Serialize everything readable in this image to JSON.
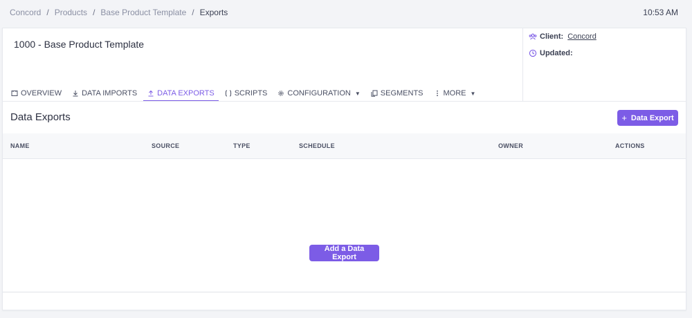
{
  "breadcrumb": {
    "items": [
      "Concord",
      "Products",
      "Base Product Template",
      "Exports"
    ],
    "separator": "/"
  },
  "clock": "10:53 AM",
  "product": {
    "title": "1000 - Base Product Template"
  },
  "meta": {
    "client_label": "Client:",
    "client_value": "Concord",
    "updated_label": "Updated:"
  },
  "tabs": [
    {
      "label": "OVERVIEW",
      "icon": "overview-icon"
    },
    {
      "label": "DATA IMPORTS",
      "icon": "download-icon"
    },
    {
      "label": "DATA EXPORTS",
      "icon": "upload-icon",
      "active": true
    },
    {
      "label": "SCRIPTS",
      "icon": "code-braces-icon"
    },
    {
      "label": "CONFIGURATION",
      "icon": "gear-icon",
      "dropdown": true
    },
    {
      "label": "SEGMENTS",
      "icon": "copy-icon"
    },
    {
      "label": "MORE",
      "icon": "kebab-icon",
      "dropdown": true
    }
  ],
  "section": {
    "title": "Data Exports",
    "add_button": "Data Export"
  },
  "table": {
    "columns": [
      "NAME",
      "SOURCE",
      "TYPE",
      "SCHEDULE",
      "OWNER",
      "ACTIONS"
    ],
    "rows": []
  },
  "empty_state": {
    "button": "Add a Data Export"
  },
  "colors": {
    "accent": "#7c5ce6",
    "background": "#f3f4f7"
  }
}
